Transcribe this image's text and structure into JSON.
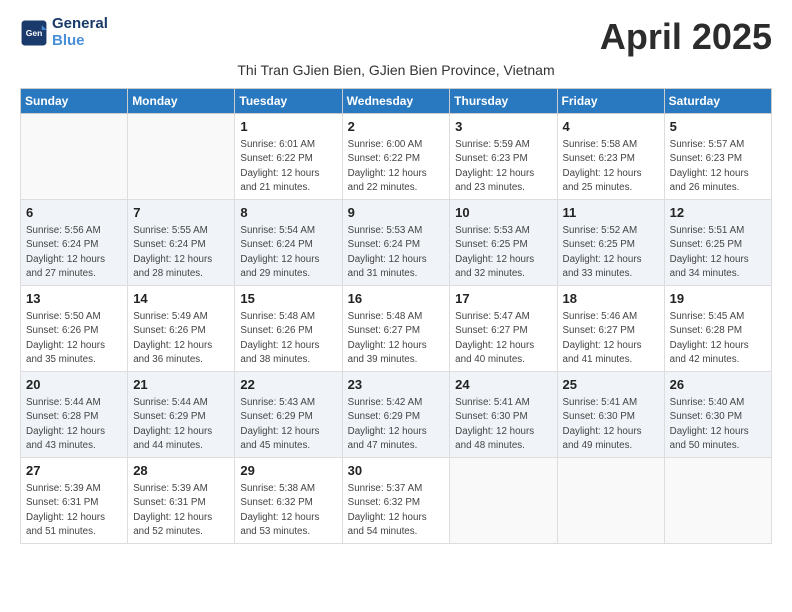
{
  "header": {
    "logo_line1": "General",
    "logo_line2": "Blue",
    "month_title": "April 2025",
    "subtitle": "Thi Tran GJien Bien, GJien Bien Province, Vietnam"
  },
  "days_of_week": [
    "Sunday",
    "Monday",
    "Tuesday",
    "Wednesday",
    "Thursday",
    "Friday",
    "Saturday"
  ],
  "weeks": [
    [
      {
        "day": "",
        "info": ""
      },
      {
        "day": "",
        "info": ""
      },
      {
        "day": "1",
        "info": "Sunrise: 6:01 AM\nSunset: 6:22 PM\nDaylight: 12 hours and 21 minutes."
      },
      {
        "day": "2",
        "info": "Sunrise: 6:00 AM\nSunset: 6:22 PM\nDaylight: 12 hours and 22 minutes."
      },
      {
        "day": "3",
        "info": "Sunrise: 5:59 AM\nSunset: 6:23 PM\nDaylight: 12 hours and 23 minutes."
      },
      {
        "day": "4",
        "info": "Sunrise: 5:58 AM\nSunset: 6:23 PM\nDaylight: 12 hours and 25 minutes."
      },
      {
        "day": "5",
        "info": "Sunrise: 5:57 AM\nSunset: 6:23 PM\nDaylight: 12 hours and 26 minutes."
      }
    ],
    [
      {
        "day": "6",
        "info": "Sunrise: 5:56 AM\nSunset: 6:24 PM\nDaylight: 12 hours and 27 minutes."
      },
      {
        "day": "7",
        "info": "Sunrise: 5:55 AM\nSunset: 6:24 PM\nDaylight: 12 hours and 28 minutes."
      },
      {
        "day": "8",
        "info": "Sunrise: 5:54 AM\nSunset: 6:24 PM\nDaylight: 12 hours and 29 minutes."
      },
      {
        "day": "9",
        "info": "Sunrise: 5:53 AM\nSunset: 6:24 PM\nDaylight: 12 hours and 31 minutes."
      },
      {
        "day": "10",
        "info": "Sunrise: 5:53 AM\nSunset: 6:25 PM\nDaylight: 12 hours and 32 minutes."
      },
      {
        "day": "11",
        "info": "Sunrise: 5:52 AM\nSunset: 6:25 PM\nDaylight: 12 hours and 33 minutes."
      },
      {
        "day": "12",
        "info": "Sunrise: 5:51 AM\nSunset: 6:25 PM\nDaylight: 12 hours and 34 minutes."
      }
    ],
    [
      {
        "day": "13",
        "info": "Sunrise: 5:50 AM\nSunset: 6:26 PM\nDaylight: 12 hours and 35 minutes."
      },
      {
        "day": "14",
        "info": "Sunrise: 5:49 AM\nSunset: 6:26 PM\nDaylight: 12 hours and 36 minutes."
      },
      {
        "day": "15",
        "info": "Sunrise: 5:48 AM\nSunset: 6:26 PM\nDaylight: 12 hours and 38 minutes."
      },
      {
        "day": "16",
        "info": "Sunrise: 5:48 AM\nSunset: 6:27 PM\nDaylight: 12 hours and 39 minutes."
      },
      {
        "day": "17",
        "info": "Sunrise: 5:47 AM\nSunset: 6:27 PM\nDaylight: 12 hours and 40 minutes."
      },
      {
        "day": "18",
        "info": "Sunrise: 5:46 AM\nSunset: 6:27 PM\nDaylight: 12 hours and 41 minutes."
      },
      {
        "day": "19",
        "info": "Sunrise: 5:45 AM\nSunset: 6:28 PM\nDaylight: 12 hours and 42 minutes."
      }
    ],
    [
      {
        "day": "20",
        "info": "Sunrise: 5:44 AM\nSunset: 6:28 PM\nDaylight: 12 hours and 43 minutes."
      },
      {
        "day": "21",
        "info": "Sunrise: 5:44 AM\nSunset: 6:29 PM\nDaylight: 12 hours and 44 minutes."
      },
      {
        "day": "22",
        "info": "Sunrise: 5:43 AM\nSunset: 6:29 PM\nDaylight: 12 hours and 45 minutes."
      },
      {
        "day": "23",
        "info": "Sunrise: 5:42 AM\nSunset: 6:29 PM\nDaylight: 12 hours and 47 minutes."
      },
      {
        "day": "24",
        "info": "Sunrise: 5:41 AM\nSunset: 6:30 PM\nDaylight: 12 hours and 48 minutes."
      },
      {
        "day": "25",
        "info": "Sunrise: 5:41 AM\nSunset: 6:30 PM\nDaylight: 12 hours and 49 minutes."
      },
      {
        "day": "26",
        "info": "Sunrise: 5:40 AM\nSunset: 6:30 PM\nDaylight: 12 hours and 50 minutes."
      }
    ],
    [
      {
        "day": "27",
        "info": "Sunrise: 5:39 AM\nSunset: 6:31 PM\nDaylight: 12 hours and 51 minutes."
      },
      {
        "day": "28",
        "info": "Sunrise: 5:39 AM\nSunset: 6:31 PM\nDaylight: 12 hours and 52 minutes."
      },
      {
        "day": "29",
        "info": "Sunrise: 5:38 AM\nSunset: 6:32 PM\nDaylight: 12 hours and 53 minutes."
      },
      {
        "day": "30",
        "info": "Sunrise: 5:37 AM\nSunset: 6:32 PM\nDaylight: 12 hours and 54 minutes."
      },
      {
        "day": "",
        "info": ""
      },
      {
        "day": "",
        "info": ""
      },
      {
        "day": "",
        "info": ""
      }
    ]
  ]
}
